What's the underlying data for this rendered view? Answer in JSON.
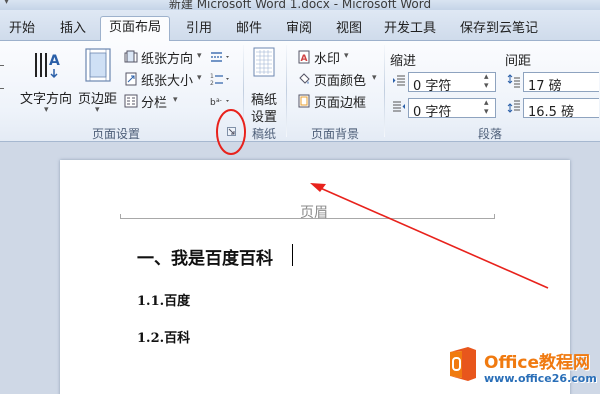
{
  "window": {
    "title": "新建 Microsoft Word 1.docx - Microsoft Word"
  },
  "tabs": [
    {
      "label": "开始"
    },
    {
      "label": "插入"
    },
    {
      "label": "页面布局"
    },
    {
      "label": "引用"
    },
    {
      "label": "邮件"
    },
    {
      "label": "审阅"
    },
    {
      "label": "视图"
    },
    {
      "label": "开发工具"
    },
    {
      "label": "保存到云笔记"
    }
  ],
  "active_tab": "页面布局",
  "ribbon": {
    "page_setup": {
      "text_direction": "文字方向",
      "margins": "页边距",
      "orientation": "纸张方向",
      "size": "纸张大小",
      "columns": "分栏",
      "group_label": "页面设置"
    },
    "draft": {
      "button": "稿纸设置",
      "button_line1": "稿纸",
      "button_line2": "设置",
      "group_label": "稿纸"
    },
    "page_background": {
      "watermark": "水印",
      "page_color": "页面颜色",
      "page_borders": "页面边框",
      "group_label": "页面背景"
    },
    "paragraph": {
      "indent_label": "缩进",
      "spacing_label": "间距",
      "indent_left": "0 字符",
      "indent_right": "0 字符",
      "spacing_before": "17 磅",
      "spacing_after": "16.5 磅",
      "group_label": "段落"
    }
  },
  "document": {
    "header_label": "页眉",
    "heading1": "一、我是百度百科",
    "heading2_a": "1.1.百度",
    "heading2_b": "1.2.百科"
  },
  "watermark_brand": {
    "name": "Office教程网",
    "url": "www.office26.com"
  },
  "colors": {
    "annotation": "#e8221c",
    "brand_orange": "#f07a10",
    "brand_blue": "#2a6fb8"
  }
}
